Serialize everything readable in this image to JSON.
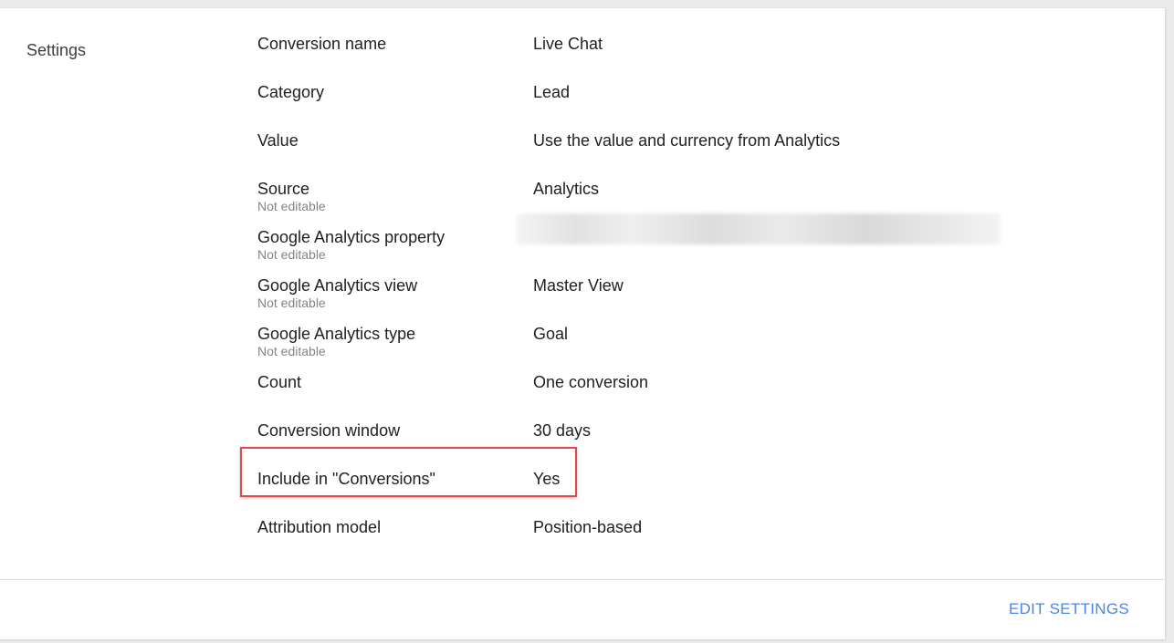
{
  "section": {
    "title": "Settings"
  },
  "settings": [
    {
      "label": "Conversion name",
      "value": "Live Chat"
    },
    {
      "label": "Category",
      "value": "Lead"
    },
    {
      "label": "Value",
      "value": "Use the value and currency from Analytics"
    },
    {
      "label": "Source",
      "sub": "Not editable",
      "value": "Analytics"
    },
    {
      "label": "Google Analytics property",
      "sub": "Not editable",
      "value": ""
    },
    {
      "label": "Google Analytics view",
      "sub": "Not editable",
      "value": "Master View"
    },
    {
      "label": "Google Analytics type",
      "sub": "Not editable",
      "value": "Goal"
    },
    {
      "label": "Count",
      "value": "One conversion"
    },
    {
      "label": "Conversion window",
      "value": "30 days"
    },
    {
      "label": "Include in \"Conversions\"",
      "value": "Yes"
    },
    {
      "label": "Attribution model",
      "value": "Position-based"
    }
  ],
  "footer": {
    "edit_label": "EDIT SETTINGS"
  },
  "colors": {
    "accent": "#4a86e8",
    "highlight": "#e0484a"
  }
}
